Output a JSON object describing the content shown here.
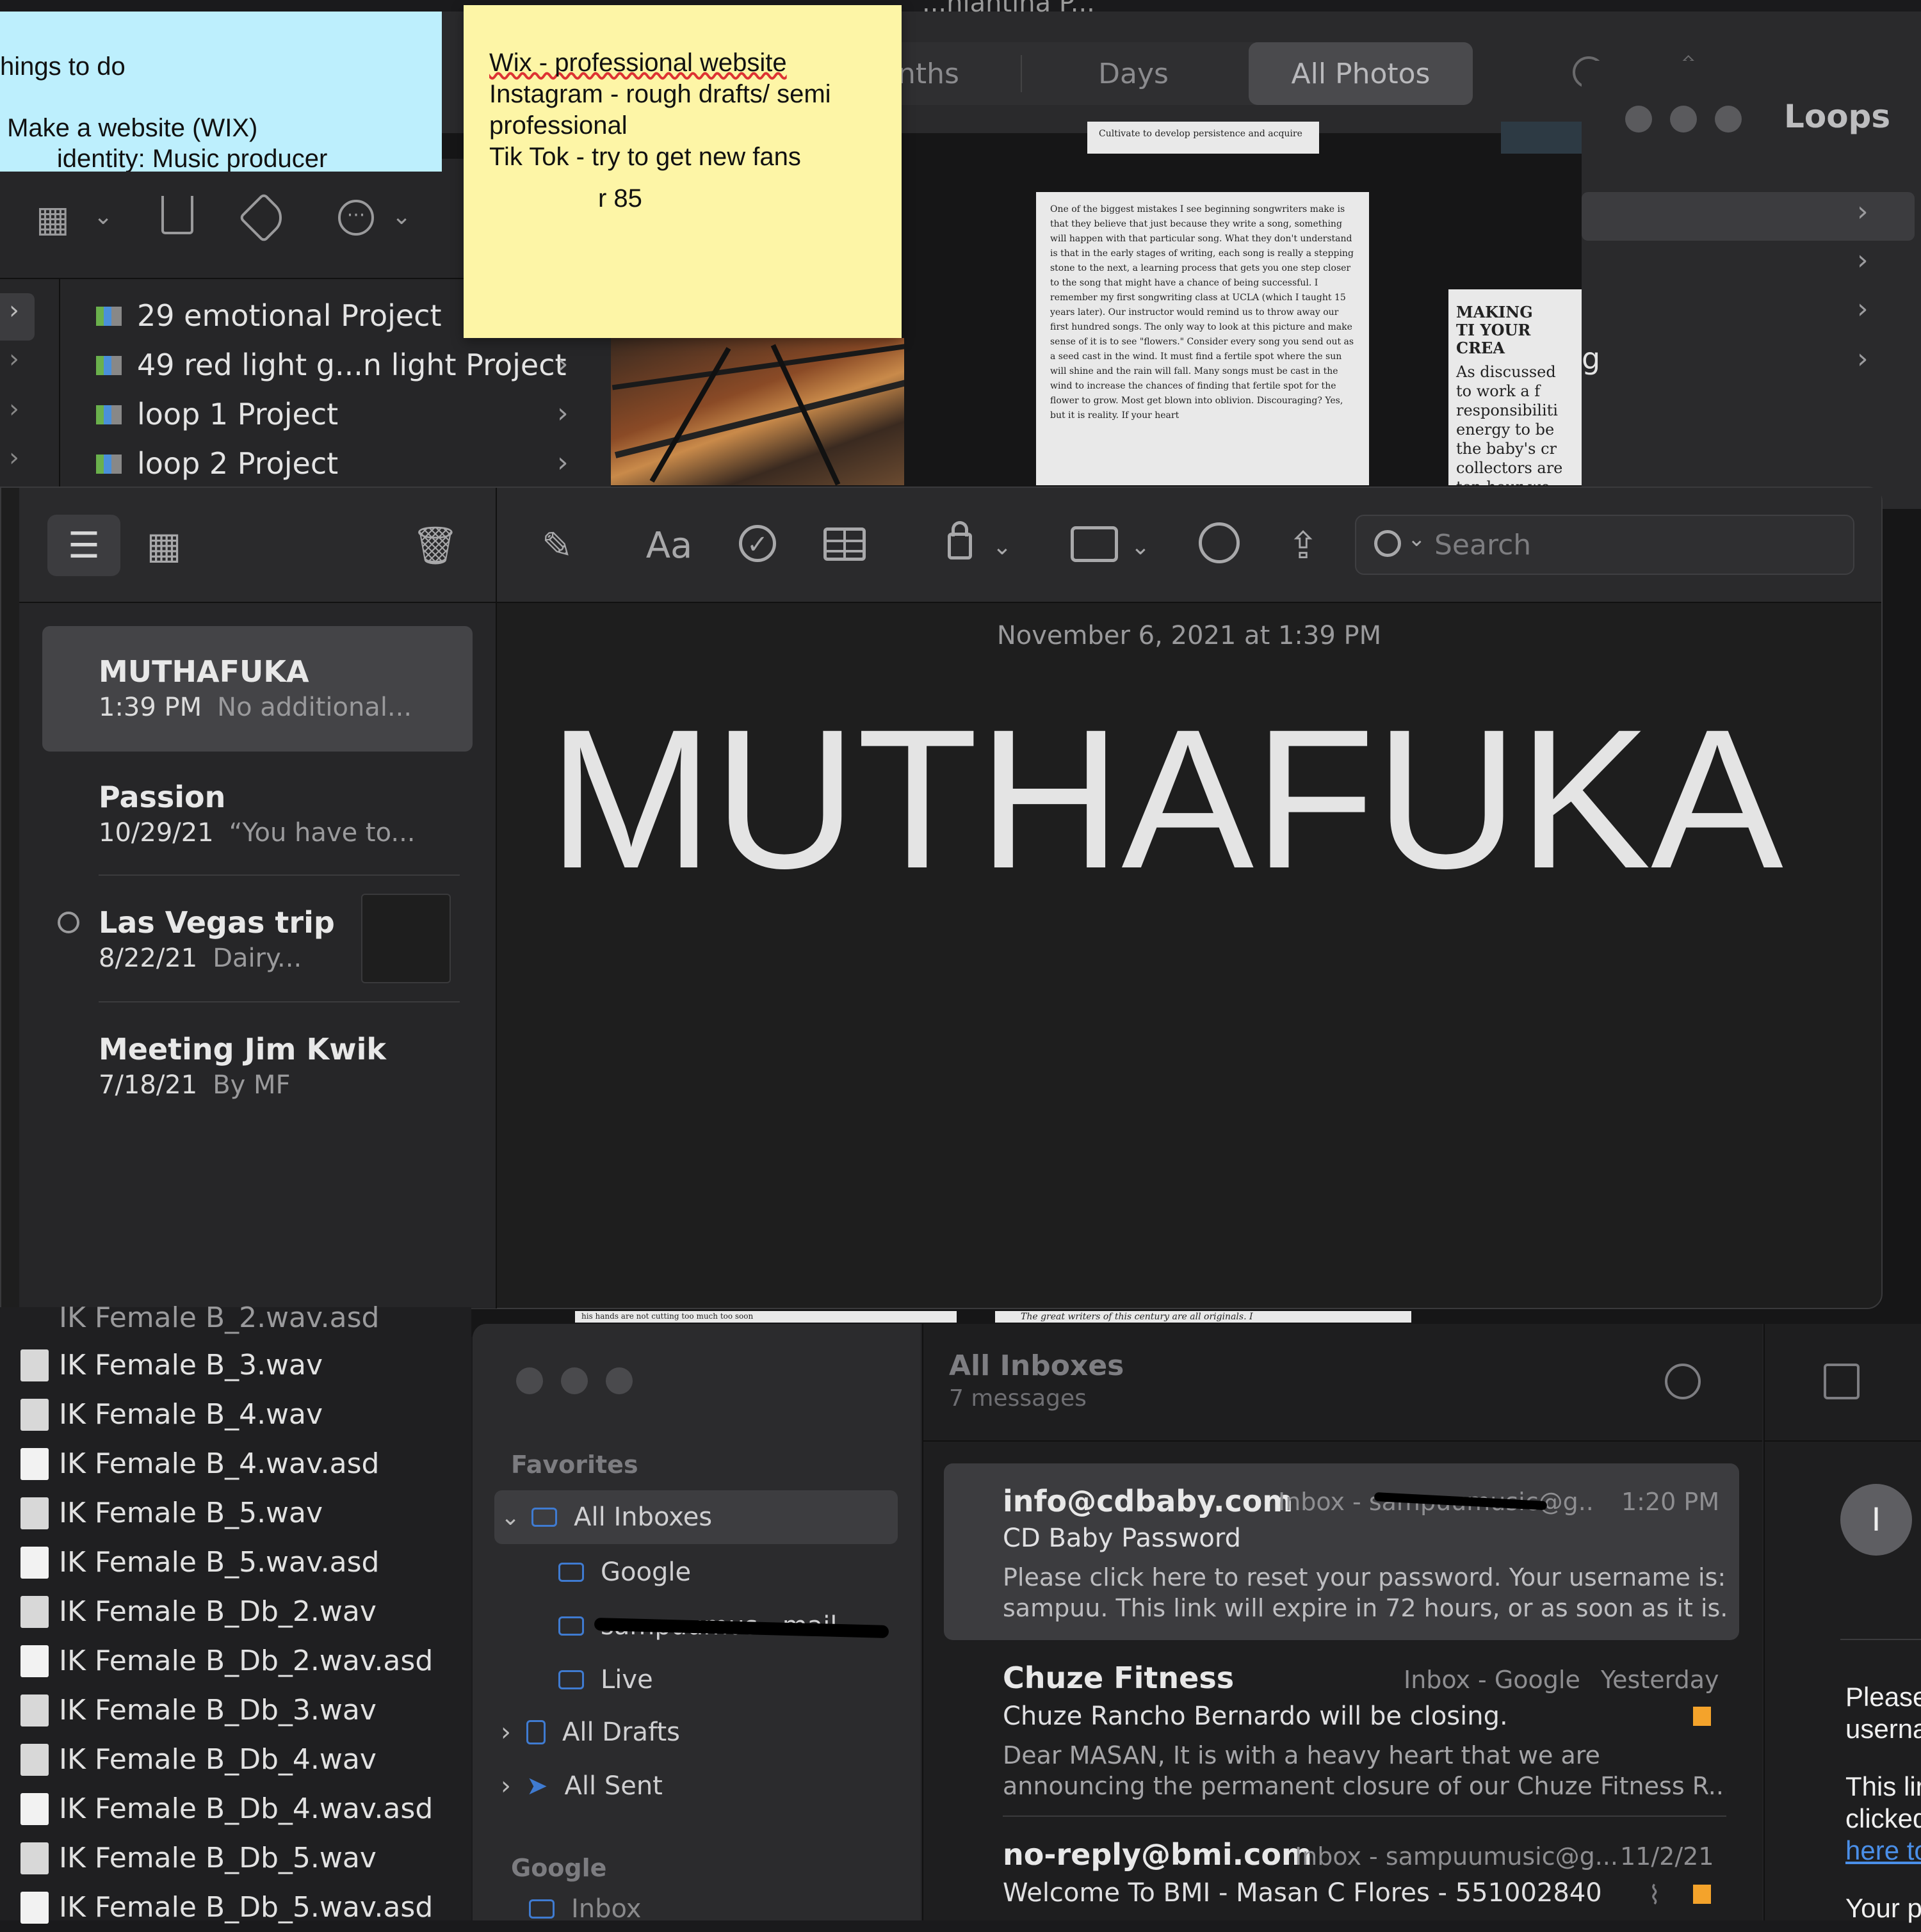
{
  "photos": {
    "title_partial": "...nlantina P...",
    "tabs": [
      {
        "label": "nths"
      },
      {
        "label": "Days"
      },
      {
        "label": "All Photos",
        "selected": true
      }
    ],
    "page1_text": "One of the biggest mistakes I see beginning songwriters make is that they believe that just because they write a song, something will happen with that particular song. What they don't understand is that in the early stages of writing, each song is really a stepping stone to the next, a learning process that gets you one step closer to the song that might have a chance of being successful. I remember my first songwriting class at UCLA (which I taught 15 years later). Our instructor would remind us to throw away our first hundred songs. The only way to look at this picture and make sense of it is to see \"flowers.\" Consider every song you send out as a seed cast in the wind. It must find a fertile spot where the sun will shine and the rain will fall. Many songs must be cast in the wind to increase the chances of finding that fertile spot for the flower to grow. Most get blown into oblivion. Discouraging? Yes, but it is reality. If your heart",
    "page2_heading": "MAKING TI YOUR CREA",
    "page2_text": "As discussed to work a f responsibiliti energy to be the baby's cr collectors are ten-hour wo",
    "page_top_text": "Cultivate to develop persistence and acquire",
    "page_bottom_text": "The great writers of this century are all originals. I",
    "page_bottom_left": "his hands are not cutting too much too soon"
  },
  "loops_window": {
    "title": "Loops",
    "partial_label": "g"
  },
  "sticky_blue": {
    "lines": [
      "hings to do",
      "",
      " Make a website (WIX)",
      "        identity: Music producer"
    ]
  },
  "sticky_yellow": {
    "lines": [
      "Wix - professional website",
      "Instagram - rough drafts/ semi",
      "professional",
      "Tik Tok - try to get new fans",
      "",
      "",
      "r 85"
    ]
  },
  "finder_projects": {
    "items": [
      {
        "label": "29 emotional Project"
      },
      {
        "label": "49 red light g...n light Project"
      },
      {
        "label": "loop 1 Project"
      },
      {
        "label": "loop 2 Project"
      }
    ]
  },
  "notes": {
    "search_placeholder": "Search",
    "list": [
      {
        "title": "MUTHAFUKA",
        "date": "1:39 PM",
        "preview": "No additional...",
        "selected": true
      },
      {
        "title": "Passion",
        "date": "10/29/21",
        "preview": "“You have to..."
      },
      {
        "title": "Las Vegas trip",
        "date": "8/22/21",
        "preview": "Dairy...",
        "shared": true
      },
      {
        "title": "Meeting Jim Kwik",
        "date": "7/18/21",
        "preview": "By MF"
      }
    ],
    "editor": {
      "timestamp": "November 6, 2021 at 1:39 PM",
      "body": "MUTHAFUKA"
    }
  },
  "files": {
    "items": [
      {
        "name": "IK Female B_2.wav.asd",
        "type": "asd"
      },
      {
        "name": "IK Female B_3.wav",
        "type": "wav"
      },
      {
        "name": "IK Female B_4.wav",
        "type": "wav"
      },
      {
        "name": "IK Female B_4.wav.asd",
        "type": "asd"
      },
      {
        "name": "IK Female B_5.wav",
        "type": "wav"
      },
      {
        "name": "IK Female B_5.wav.asd",
        "type": "asd"
      },
      {
        "name": "IK Female B_Db_2.wav",
        "type": "wav"
      },
      {
        "name": "IK Female B_Db_2.wav.asd",
        "type": "asd"
      },
      {
        "name": "IK Female B_Db_3.wav",
        "type": "wav"
      },
      {
        "name": "IK Female B_Db_4.wav",
        "type": "wav"
      },
      {
        "name": "IK Female B_Db_4.wav.asd",
        "type": "asd"
      },
      {
        "name": "IK Female B_Db_5.wav",
        "type": "wav"
      },
      {
        "name": "IK Female B_Db_5.wav.asd",
        "type": "asd"
      }
    ]
  },
  "mail": {
    "sidebar": {
      "favorites_label": "Favorites",
      "all_inboxes": "All Inboxes",
      "google": "Google",
      "redacted_mailbox": "sampuumus...mail...",
      "live": "Live",
      "all_drafts": "All Drafts",
      "all_sent": "All Sent",
      "google_section": "Google",
      "inbox": "Inbox"
    },
    "list_header": {
      "title": "All Inboxes",
      "count": "7 messages"
    },
    "messages": [
      {
        "from": "info@cdbaby.com",
        "mailbox": "Inbox - sampuumusic@g...",
        "time": "1:20 PM",
        "subject": "CD Baby Password",
        "preview1": "Please click here to reset your password. Your username is:",
        "preview2": "sampuu. This link will expire in 72 hours, or as soon as it is...",
        "selected": true
      },
      {
        "from": "Chuze Fitness",
        "mailbox": "Inbox - Google",
        "time": "Yesterday",
        "subject": "Chuze Rancho Bernardo will be closing.",
        "preview1": "Dear MASAN, It is with a heavy heart that we are",
        "preview2": "announcing the permanent closure of our Chuze Fitness R...",
        "flagged": true
      },
      {
        "from": "no-reply@bmi.com",
        "mailbox": "Inbox - sampuumusic@g...",
        "time": "11/2/21",
        "subject": "Welcome To BMI - Masan C Flores  - 551002840",
        "flagged": true,
        "attachment": true
      }
    ],
    "reading": {
      "avatar_letter": "I",
      "line1": "Please",
      "line2": "userna",
      "line3": "This lir",
      "line4": "clicked",
      "link": "here to",
      "line5": "Your p"
    }
  },
  "colors": {
    "accent_blue": "#3f7bd1",
    "flag_orange": "#f4a32b",
    "sticky_yellow": "#fdf5a6",
    "sticky_blue": "#bdeffd",
    "link_blue": "#4a8fe8"
  }
}
